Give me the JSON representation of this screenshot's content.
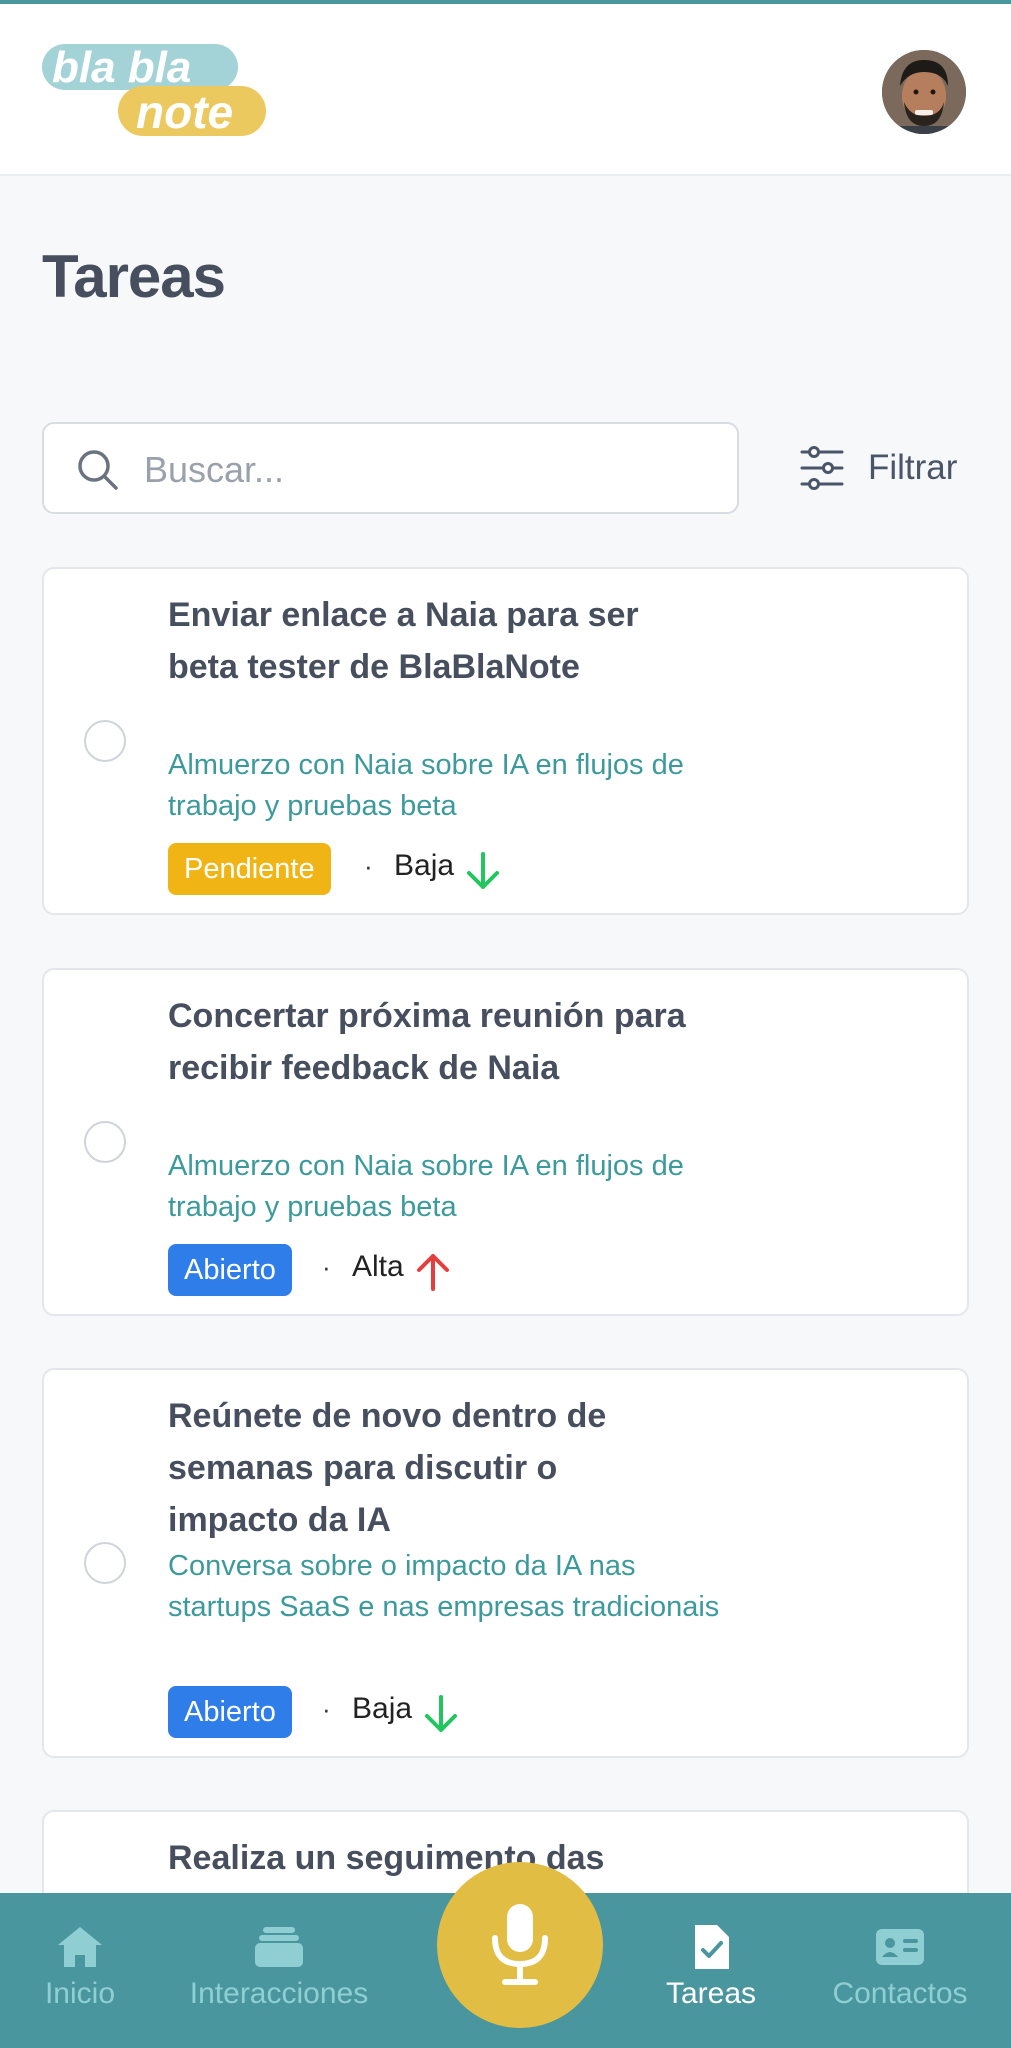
{
  "app": {
    "logo_text_top": "bla bla",
    "logo_text_bottom": "note"
  },
  "page": {
    "title": "Tareas"
  },
  "search": {
    "placeholder": "Buscar..."
  },
  "filter": {
    "label": "Filtrar"
  },
  "tasks": [
    {
      "title": "Enviar enlace a Naia para ser beta tester de BlaBlaNote",
      "subtitle": "Almuerzo con Naia sobre IA en flujos de trabajo y pruebas beta",
      "status": "Pendiente",
      "priority": "Baja",
      "priority_direction": "down"
    },
    {
      "title": "Concertar próxima reunión para recibir feedback de Naia",
      "subtitle": "Almuerzo con Naia sobre IA en flujos de trabajo y pruebas beta",
      "status": "Abierto",
      "priority": "Alta",
      "priority_direction": "up"
    },
    {
      "title": "Reúnete de novo dentro de semanas para discutir o impacto da IA",
      "subtitle": "Conversa sobre o impacto da IA nas startups SaaS e nas empresas tradicionais",
      "status": "Abierto",
      "priority": "Baja",
      "priority_direction": "down"
    },
    {
      "title": "Realiza un seguimento das"
    }
  ],
  "nav": {
    "items": [
      {
        "label": "Inicio",
        "icon": "home-icon"
      },
      {
        "label": "Interacciones",
        "icon": "inbox-icon"
      },
      {
        "label": "Tareas",
        "icon": "task-icon"
      },
      {
        "label": "Contactos",
        "icon": "contact-card-icon"
      }
    ],
    "mic_icon": "microphone-icon"
  },
  "colors": {
    "accent": "#4a969e",
    "mic": "#e2bd43",
    "pendiente": "#f0b515",
    "abierto": "#2f7de8",
    "priority_low": "#22c55e",
    "priority_high": "#e53e3e"
  }
}
